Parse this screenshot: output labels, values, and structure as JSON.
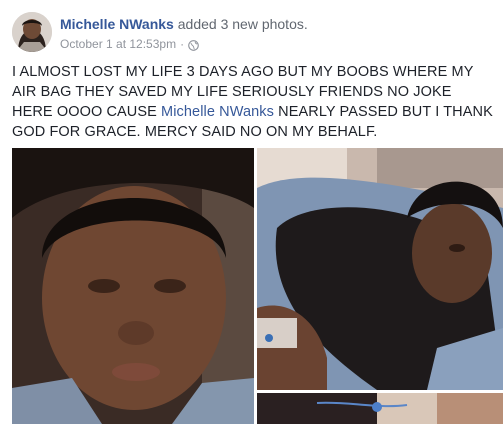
{
  "post": {
    "author": "Michelle NWanks",
    "action": "added 3 new photos.",
    "timestamp": "October 1 at 12:53pm",
    "separator": "·",
    "privacy_icon": "globe-icon",
    "text_part1": "I ALMOST LOST MY LIFE 3 DAYS AGO BUT MY BOOBS WHERE MY AIR BAG THEY SAVED MY LIFE SERIOUSLY FRIENDS NO JOKE HERE OOOO CAUSE ",
    "mention": "Michelle NWanks",
    "text_part2": " NEARLY PASSED BUT I THANK GOD FOR GRACE. MERCY SAID NO ON MY BEHALF."
  },
  "colors": {
    "link": "#365899",
    "text": "#1d2129",
    "meta": "#90949c"
  }
}
